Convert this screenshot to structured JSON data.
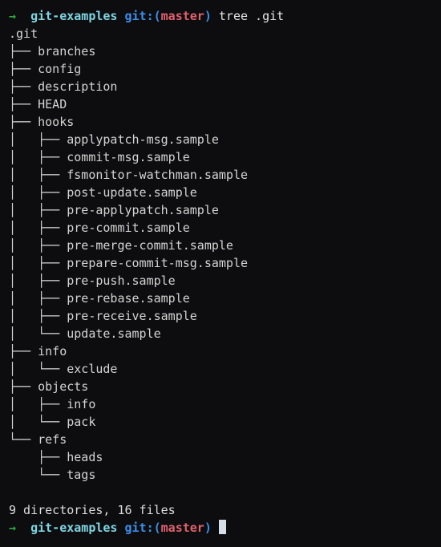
{
  "terminal": {
    "background_color": "#0d0d0f",
    "foreground_color": "#dcdcdc",
    "prompt": {
      "arrow": "→",
      "gap1": "  ",
      "cwd": "git-examples",
      "gap2": " ",
      "git_open": "git:(",
      "branch": "master",
      "git_close": ")",
      "gap3": " "
    },
    "colors": {
      "arrow": "#2bab3d",
      "cwd": "#7fd4e0",
      "git_paren": "#3b8eea",
      "branch": "#e0616f",
      "command": "#e6e6e6",
      "tree": "#d4d4d4",
      "cursor": "#d8dee9"
    },
    "command": "tree .git",
    "root": ".git",
    "tree_lines": [
      "├── branches",
      "├── config",
      "├── description",
      "├── HEAD",
      "├── hooks",
      "│   ├── applypatch-msg.sample",
      "│   ├── commit-msg.sample",
      "│   ├── fsmonitor-watchman.sample",
      "│   ├── post-update.sample",
      "│   ├── pre-applypatch.sample",
      "│   ├── pre-commit.sample",
      "│   ├── pre-merge-commit.sample",
      "│   ├── prepare-commit-msg.sample",
      "│   ├── pre-push.sample",
      "│   ├── pre-rebase.sample",
      "│   ├── pre-receive.sample",
      "│   └── update.sample",
      "├── info",
      "│   └── exclude",
      "├── objects",
      "│   ├── info",
      "│   └── pack",
      "└── refs",
      "    ├── heads",
      "    └── tags"
    ],
    "summary": "9 directories, 16 files"
  }
}
